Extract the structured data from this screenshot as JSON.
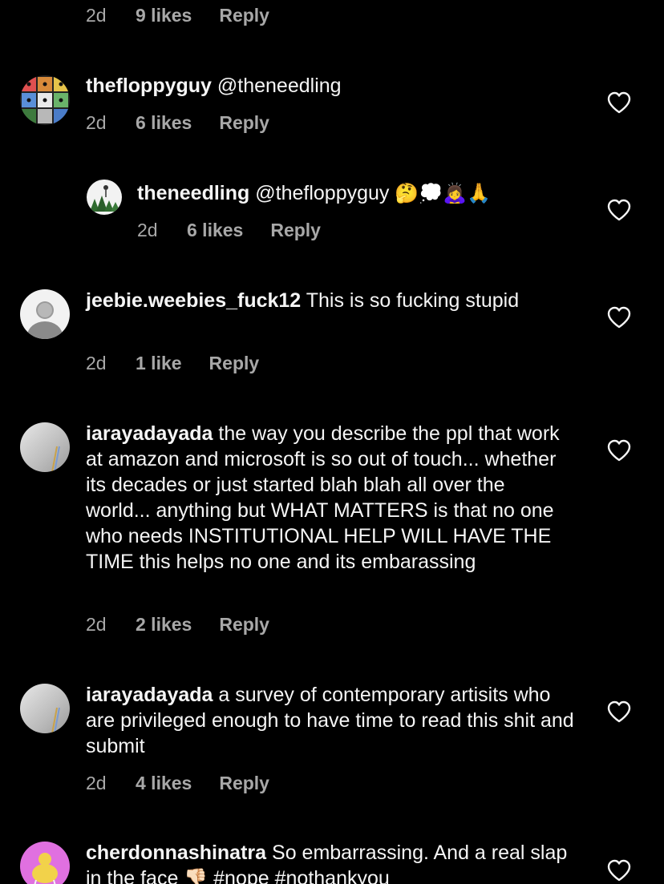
{
  "comments": [
    {
      "meta": {
        "time": "2d",
        "likes": "9 likes",
        "reply": "Reply"
      }
    },
    {
      "username": "thefloppyguy",
      "text": "@theneedling",
      "meta": {
        "time": "2d",
        "likes": "6 likes",
        "reply": "Reply"
      }
    },
    {
      "username": "theneedling",
      "text": "@thefloppyguy",
      "emoji": [
        "🤔",
        "💭",
        "🙇‍♀️",
        "🙏"
      ],
      "meta": {
        "time": "2d",
        "likes": "6 likes",
        "reply": "Reply"
      }
    },
    {
      "username": "jeebie.weebies_fuck12",
      "text": "This is so fucking stupid",
      "meta": {
        "time": "2d",
        "likes": "1 like",
        "reply": "Reply"
      }
    },
    {
      "username": "iarayadayada",
      "text": "the way you describe the ppl that work at amazon and microsoft is so out of touch... whether its decades or just started blah blah all over the world... anything but WHAT MATTERS is that no one who needs INSTITUTIONAL HELP WILL HAVE THE TIME this helps no one and its embarassing",
      "meta": {
        "time": "2d",
        "likes": "2 likes",
        "reply": "Reply"
      }
    },
    {
      "username": "iarayadayada",
      "text": "a survey of contemporary artisits who are privileged enough to have time to read this shit and submit",
      "meta": {
        "time": "2d",
        "likes": "4 likes",
        "reply": "Reply"
      }
    },
    {
      "username": "cherdonnashinatra",
      "text": "So embarrassing. And a real slap in the face",
      "emoji": "👎🏻",
      "hashtags": "#nope #nothankyou"
    }
  ],
  "colors": {
    "background": "#000000",
    "text": "#f5f5f5",
    "secondary": "#a8a8a8"
  },
  "icons": {
    "like": "heart-outline-icon"
  }
}
